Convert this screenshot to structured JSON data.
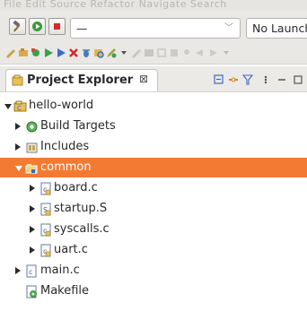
{
  "menubar": {
    "text": "File  Edit  Source  Refactor  Navigate  Search"
  },
  "toolbar": {
    "config_combo": {
      "value": "—"
    },
    "launch_combo": {
      "value": "No Launch configurations"
    }
  },
  "view": {
    "tab_title": "Project Explorer",
    "close_glyph": "⊠"
  },
  "tree": {
    "project": {
      "label": "hello-world"
    },
    "build_targets": {
      "label": "Build Targets"
    },
    "includes": {
      "label": "Includes"
    },
    "common": {
      "label": "common"
    },
    "files": [
      {
        "label": "board.c"
      },
      {
        "label": "startup.S"
      },
      {
        "label": "syscalls.c"
      },
      {
        "label": "uart.c"
      }
    ],
    "main": {
      "label": "main.c"
    },
    "makefile": {
      "label": "Makefile"
    }
  },
  "colors": {
    "selection": "#f37a32",
    "toolbar_bg": "#e9e8e5"
  }
}
